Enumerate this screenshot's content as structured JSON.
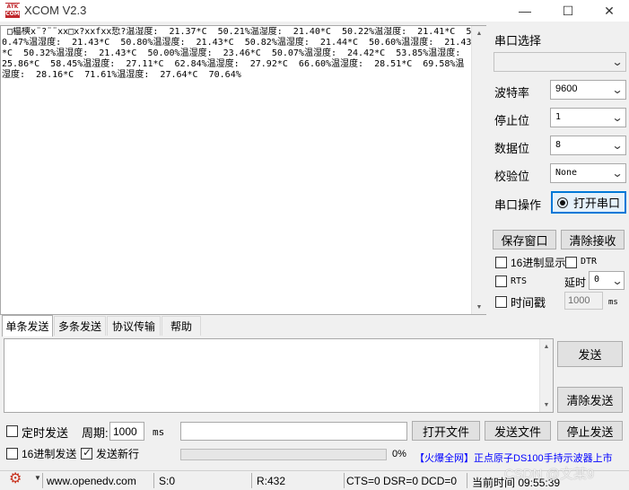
{
  "window": {
    "title": "XCOM V2.3",
    "logo_top": "ATK",
    "logo_bottom": "COM",
    "minimize": "—",
    "maximize": "☐",
    "close": "✕"
  },
  "receive": {
    "text": " □橸樉x¨?¨¨xx□x?xxfxx悊?温湿度:  21.37*C  50.21%温湿度:  21.40*C  50.22%温湿度:  21.41*C  50.47%温湿度:  21.43*C  50.80%温湿度:  21.43*C  50.82%温湿度:  21.44*C  50.60%温湿度:  21.43*C  50.32%温湿度:  21.43*C  50.00%温湿度:  23.46*C  50.07%温湿度:  24.42*C  53.85%温湿度:  25.86*C  58.45%温湿度:  27.11*C  62.84%温湿度:  27.92*C  66.60%温湿度:  28.51*C  69.58%温湿度:  28.16*C  71.61%温湿度:  27.64*C  70.64%"
  },
  "settings": {
    "port_label": "串口选择",
    "port_value": "",
    "baud_label": "波特率",
    "baud_value": "9600",
    "stopbits_label": "停止位",
    "stopbits_value": "1",
    "databits_label": "数据位",
    "databits_value": "8",
    "parity_label": "校验位",
    "parity_value": "None",
    "operation_label": "串口操作",
    "open_port_button": "打开串口",
    "save_window_button": "保存窗口",
    "clear_receive_button": "清除接收",
    "hex_display_label": "16进制显示",
    "dtr_label": "DTR",
    "rts_label": "RTS",
    "delay_label": "延时",
    "delay_value": "0",
    "timestamp_label": "时间戳",
    "timestamp_value": "1000",
    "timestamp_unit": "ms"
  },
  "tabs": [
    {
      "label": "单条发送"
    },
    {
      "label": "多条发送"
    },
    {
      "label": "协议传输"
    },
    {
      "label": "帮助"
    }
  ],
  "send": {
    "send_button": "发送",
    "clear_send_button": "清除发送",
    "timed_send_label": "定时发送",
    "period_label": "周期:",
    "period_value": "1000",
    "period_unit": "ms",
    "open_file_button": "打开文件",
    "send_file_button": "发送文件",
    "stop_send_button": "停止发送",
    "hex_send_label": "16进制发送",
    "newline_label": "发送新行",
    "progress_text": "0%",
    "progress": 0,
    "ad_text": "【火爆全网】正点原子DS100手持示波器上市"
  },
  "status": {
    "website": "www.openedv.com",
    "sent": "S:0",
    "received": "R:432",
    "signals": "CTS=0 DSR=0 DCD=0",
    "time": "当前时间 09:55:39",
    "watermark": "CSDN @文某9"
  },
  "colors": {
    "accent_blue": "#0078d7",
    "ad_blue": "#0000ff",
    "gear_red": "#c8321e",
    "logo_red": "#c0282d"
  },
  "icons": {
    "settings": "gear-icon",
    "dropdown": "chevron-down-icon",
    "radio": "radio-button-icon"
  }
}
